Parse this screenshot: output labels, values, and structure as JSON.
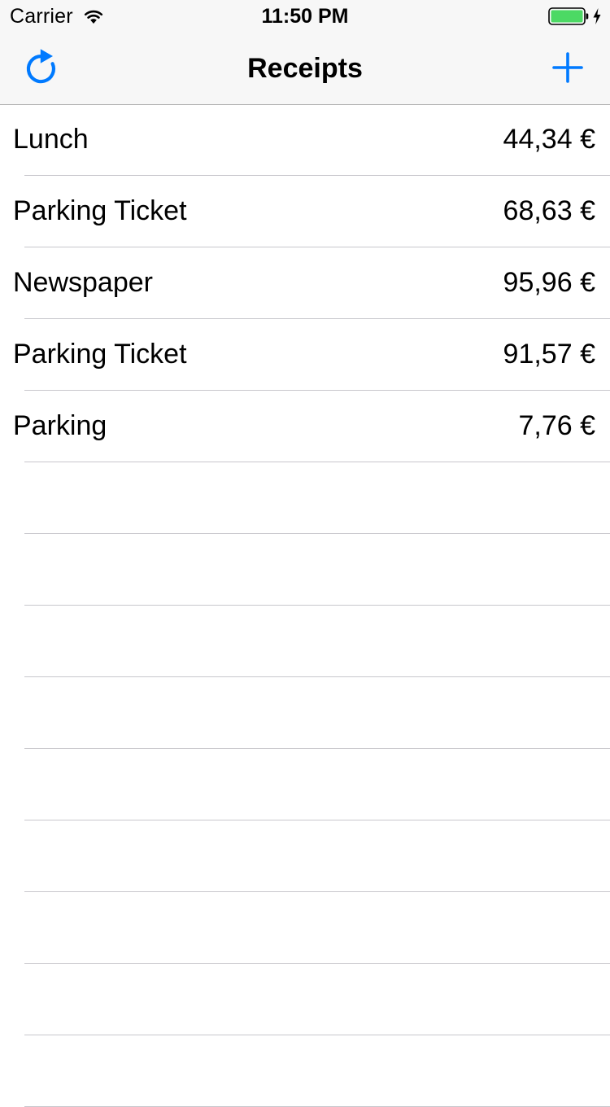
{
  "status_bar": {
    "carrier": "Carrier",
    "time": "11:50 PM",
    "wifi_icon": "wifi-icon",
    "battery_icon": "battery-icon",
    "charging_icon": "charging-bolt-icon",
    "battery_color": "#4cd964"
  },
  "nav_bar": {
    "title": "Receipts",
    "left_button_icon": "refresh-icon",
    "right_button_icon": "plus-icon",
    "accent_color": "#007aff"
  },
  "receipts": [
    {
      "title": "Lunch",
      "amount": "44,34 €"
    },
    {
      "title": "Parking Ticket",
      "amount": "68,63 €"
    },
    {
      "title": "Newspaper",
      "amount": "95,96 €"
    },
    {
      "title": "Parking Ticket",
      "amount": "91,57 €"
    },
    {
      "title": "Parking",
      "amount": "7,76 €"
    },
    {
      "title": "",
      "amount": ""
    },
    {
      "title": "",
      "amount": ""
    },
    {
      "title": "",
      "amount": ""
    },
    {
      "title": "",
      "amount": ""
    },
    {
      "title": "",
      "amount": ""
    },
    {
      "title": "",
      "amount": ""
    },
    {
      "title": "",
      "amount": ""
    },
    {
      "title": "",
      "amount": ""
    },
    {
      "title": "",
      "amount": ""
    }
  ]
}
